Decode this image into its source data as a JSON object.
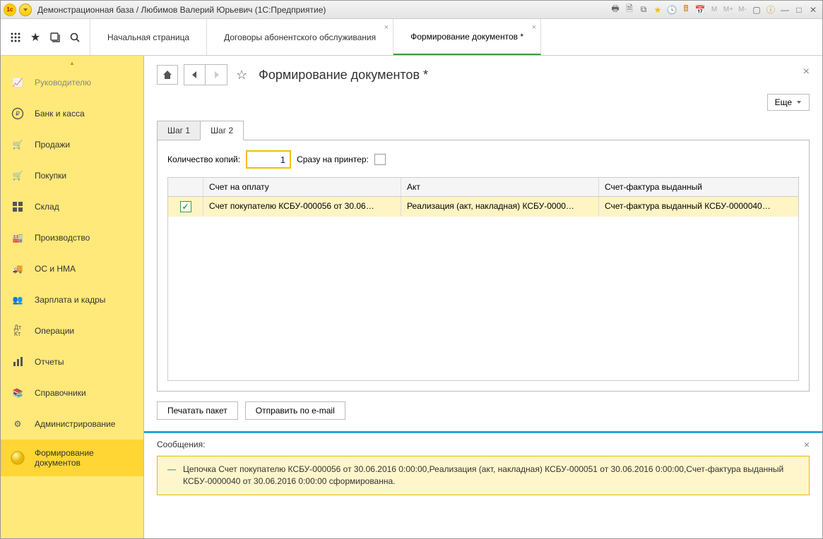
{
  "window": {
    "title": "Демонстрационная база / Любимов Валерий Юрьевич  (1С:Предприятие)"
  },
  "tabs": [
    {
      "label": "Начальная страница",
      "active": false,
      "closable": false
    },
    {
      "label": "Договоры абонентского обслуживания",
      "active": false,
      "closable": true
    },
    {
      "label": "Формирование документов *",
      "active": true,
      "closable": true
    }
  ],
  "sidebar": {
    "items": [
      {
        "label": "Руководителю",
        "muted": true
      },
      {
        "label": "Банк и касса"
      },
      {
        "label": "Продажи"
      },
      {
        "label": "Покупки"
      },
      {
        "label": "Склад"
      },
      {
        "label": "Производство"
      },
      {
        "label": "ОС и НМА"
      },
      {
        "label": "Зарплата и кадры"
      },
      {
        "label": "Операции"
      },
      {
        "label": "Отчеты"
      },
      {
        "label": "Справочники"
      },
      {
        "label": "Администрирование"
      },
      {
        "label": "Формирование документов",
        "highlighted": true
      }
    ]
  },
  "page": {
    "title": "Формирование документов *",
    "more_label": "Еще",
    "step_tabs": {
      "t1": "Шаг 1",
      "t2": "Шаг 2"
    },
    "fields": {
      "copies_label": "Количество копий:",
      "copies_value": "1",
      "printer_label": "Сразу на принтер:"
    },
    "grid": {
      "headers": {
        "c1": "Счет на оплату",
        "c2": "Акт",
        "c3": "Счет-фактура выданный"
      },
      "row": {
        "checked": true,
        "c1": "Счет покупателю КСБУ-000056 от 30.06…",
        "c2": "Реализация (акт, накладная) КСБУ-0000…",
        "c3": "Счет-фактура выданный КСБУ-0000040…"
      }
    },
    "buttons": {
      "print": "Печатать пакет",
      "email": "Отправить по e-mail"
    }
  },
  "messages": {
    "header": "Сообщения:",
    "text": "Цепочка Счет покупателю КСБУ-000056 от 30.06.2016 0:00:00,Реализация (акт, накладная) КСБУ-000051 от 30.06.2016 0:00:00,Счет-фактура выданный КСБУ-0000040 от 30.06.2016 0:00:00 сформированна."
  }
}
